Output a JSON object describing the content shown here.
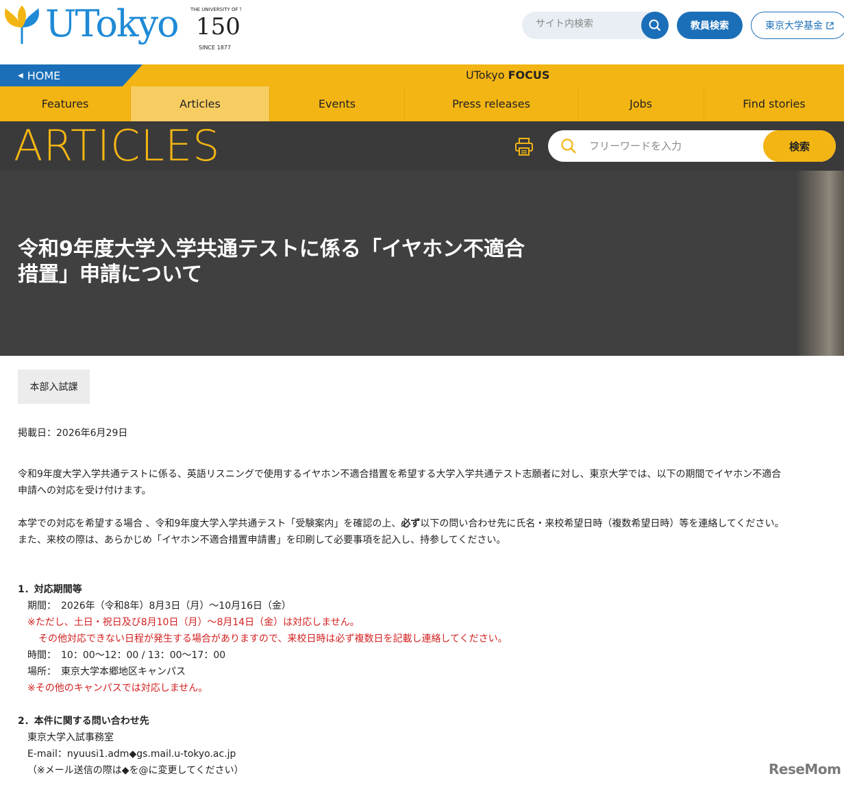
{
  "header": {
    "brand": "UTokyo",
    "badge_number": "150",
    "badge_top": "THE UNIVERSITY OF TOKYO",
    "badge_bottom": "SINCE 1877",
    "site_search_placeholder": "サイト内検索",
    "faculty_search": "教員検索",
    "fund_link": "東京大学基金"
  },
  "topbar": {
    "home": "HOME",
    "focus_prefix": "UTokyo ",
    "focus_bold": "FOCUS"
  },
  "nav": {
    "items": [
      {
        "label": "Features"
      },
      {
        "label": "Articles"
      },
      {
        "label": "Events"
      },
      {
        "label": "Press releases"
      },
      {
        "label": "Jobs"
      },
      {
        "label": "Find stories"
      }
    ]
  },
  "articles": {
    "title": "ARTICLES",
    "search_placeholder": "フリーワードを入力",
    "search_button": "検索"
  },
  "hero": {
    "title_line1": "令和9年度大学入学共通テストに係る「イヤホン不適合",
    "title_line2": "措置」申請について"
  },
  "article": {
    "department": "本部入試課",
    "date": "掲載日：2026年6月29日",
    "para1_line1": "令和9年度大学入学共通テストに係る、英語リスニングで使用するイヤホン不適合措置を希望する大学入学共通テスト志願者に対し、東京大学では、以下の期間でイヤホン不適合",
    "para1_line2": "申請への対応を受け付けます。",
    "para2_pre": "本学での対応を希望する場合 、令和9年度大学入学共通テスト「受験案内」を確認の上、",
    "para2_bold": "必ず",
    "para2_post": "以下の問い合わせ先に氏名・来校希望日時（複数希望日時）等を連絡してください。",
    "para2_line2": "また、来校の際は、あらかじめ「イヤホン不適合措置申請書」を印刷して必要事項を記入し、持参してください。",
    "section1_heading": "1．対応期間等",
    "period": "期間：　2026年（令和8年）8月3日（月）～10月16日（金）",
    "period_note1": "※ただし、土日・祝日及び8月10日（月）～8月14日（金）は対応しません。",
    "period_note2": "その他対応できない日程が発生する場合がありますので、来校日時は必ず複数日を記載し連絡してください。",
    "time": "時間：　10：00～12：00 / 13：00～17：00",
    "place": "場所：　東京大学本郷地区キャンパス",
    "place_note": "※その他のキャンパスでは対応しません。",
    "section2_heading": "2．本件に関する問い合わせ先",
    "contact_office": "東京大学入試事務室",
    "contact_email": "E-mail：nyuusi1.adm◆gs.mail.u-tokyo.ac.jp",
    "contact_note": "（※メール送信の際は◆を@に変更してください）"
  },
  "watermark": "ReseMom"
}
